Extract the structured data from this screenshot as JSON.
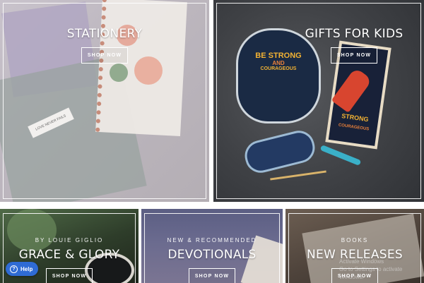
{
  "tiles": {
    "stationery": {
      "title": "STATIONERY",
      "button": "SHOP NOW"
    },
    "gifts": {
      "title": "GIFTS FOR KIDS",
      "button": "SHOP NOW"
    },
    "grace": {
      "kicker": "BY LOUIE GIGLIO",
      "title": "GRACE & GLORY",
      "button": "SHOP NOW"
    },
    "devotionals": {
      "kicker": "NEW & RECOMMENDED",
      "title": "DEVOTIONALS",
      "button": "SHOP NOW"
    },
    "releases": {
      "kicker": "BOOKS",
      "title": "NEW RELEASES",
      "button": "SHOP NOW"
    }
  },
  "images": {
    "gifts": {
      "sticker_big": "BE STRONG",
      "sticker_and": "AND",
      "sticker_cour": "COURAGEOUS",
      "book": "STRONG",
      "book_sub": "COURAGEOUS"
    },
    "stationery": {
      "card": "LOVE NEVER FAILS"
    }
  },
  "help": {
    "label": "Help"
  },
  "watermark": {
    "line1": "Activate Windows",
    "line2": "Go to Settings to activate Windows."
  },
  "colors": {
    "help_blue": "#2f6bd4",
    "frame": "#ffffff"
  }
}
